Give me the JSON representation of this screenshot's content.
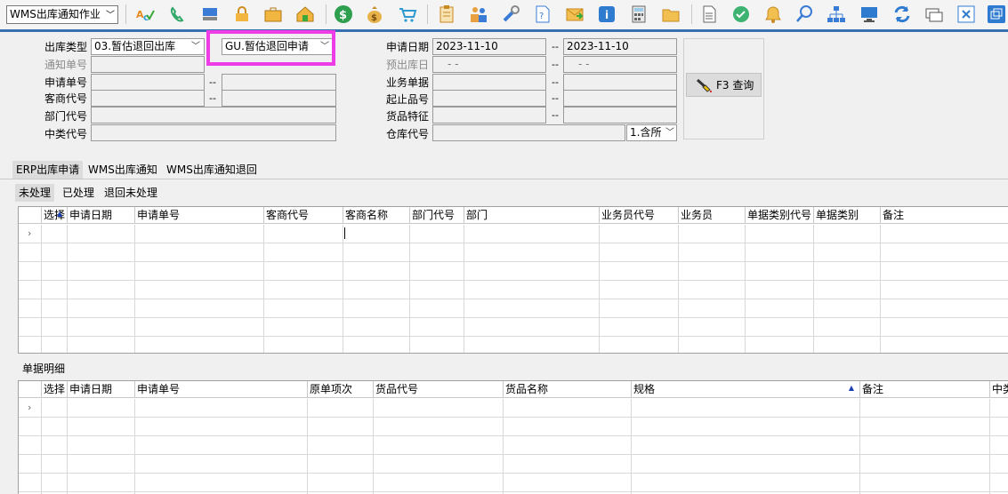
{
  "toolbar": {
    "module_select": "WMS出库通知作业",
    "icons": [
      "spell-check-icon",
      "phone-icon",
      "computer-icon",
      "lock-icon",
      "briefcase-icon",
      "home-icon",
      "dollar-icon",
      "money-bag-icon",
      "cart-icon",
      "clipboard-icon",
      "users-icon",
      "tools-icon",
      "help-doc-icon",
      "mail-icon",
      "info-icon",
      "calculator-icon",
      "folder-icon",
      "document-icon",
      "check-circle-icon",
      "bell-icon",
      "search-icon",
      "org-chart-icon",
      "monitor-icon",
      "refresh-icon",
      "window-icon",
      "close-window-icon",
      "restore-window-icon"
    ]
  },
  "query": {
    "out_type_label": "出库类型",
    "out_type_value": "03.暂估退回出库",
    "request_type_value": "GU.暂估退回申请",
    "notice_no_label": "通知单号",
    "request_no_label": "申请单号",
    "vendor_code_label": "客商代号",
    "dept_code_label": "部门代号",
    "mid_class_label": "中类代号",
    "request_date_label": "申请日期",
    "request_date_from": "2023-11-10",
    "request_date_to": "2023-11-10",
    "pre_out_date_label": "预出库日",
    "pre_out_date_from": " -  - ",
    "pre_out_date_to": " -  - ",
    "biz_doc_label": "业务单据",
    "item_range_label": "起止品号",
    "goods_feature_label": "货品特征",
    "warehouse_label": "仓库代号",
    "warehouse_scope": "1.含所",
    "range_sep": "--",
    "query_button": "F3 查询"
  },
  "tabs": {
    "main": [
      "ERP出库申请",
      "WMS出库通知",
      "WMS出库通知退回"
    ],
    "sub": [
      "未处理",
      "已处理",
      "退回未处理"
    ]
  },
  "grid1": {
    "columns": [
      "选择",
      "申请日期",
      "申请单号",
      "客商代号",
      "客商名称",
      "部门代号",
      "部门",
      "业务员代号",
      "业务员",
      "单据类别代号",
      "单据类别",
      "备注"
    ]
  },
  "detail": {
    "title": "单据明细",
    "columns": [
      "选择",
      "申请日期",
      "申请单号",
      "原单项次",
      "货品代号",
      "货品名称",
      "规格",
      "备注",
      "中类"
    ]
  }
}
